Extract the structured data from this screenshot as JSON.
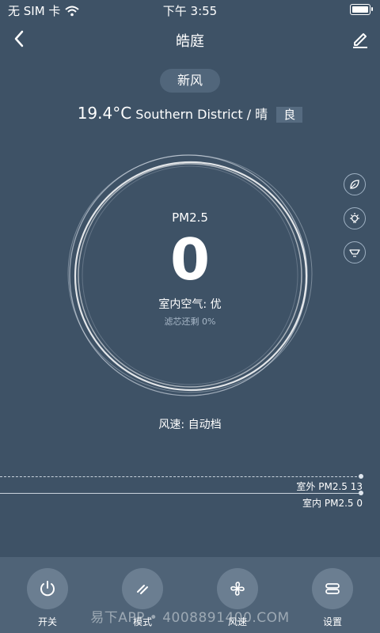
{
  "status": {
    "carrier": "无 SIM 卡",
    "time": "下午 3:55"
  },
  "header": {
    "title": "皓庭"
  },
  "mode": "新风",
  "weather": {
    "temperature": "19.4°C",
    "location": "Southern District / 晴",
    "air_quality": "良"
  },
  "gauge": {
    "label": "PM2.5",
    "value": "0",
    "indoor_air": "室内空气: 优",
    "filter": "滤芯还剩 0%"
  },
  "fan_speed": "风速: 自动档",
  "pm_lines": {
    "outdoor": "室外 PM2.5 13",
    "indoor": "室内 PM2.5 0"
  },
  "bottom_nav": [
    {
      "label": "开关",
      "icon": "power-icon"
    },
    {
      "label": "模式",
      "icon": "mode-icon"
    },
    {
      "label": "风速",
      "icon": "fan-icon"
    },
    {
      "label": "设置",
      "icon": "settings-icon"
    }
  ],
  "watermark": "易下APP • 4008891400.COM",
  "colors": {
    "background": "#3e5266",
    "bottom_bar": "#4f6377",
    "button": "#6b7e91"
  }
}
